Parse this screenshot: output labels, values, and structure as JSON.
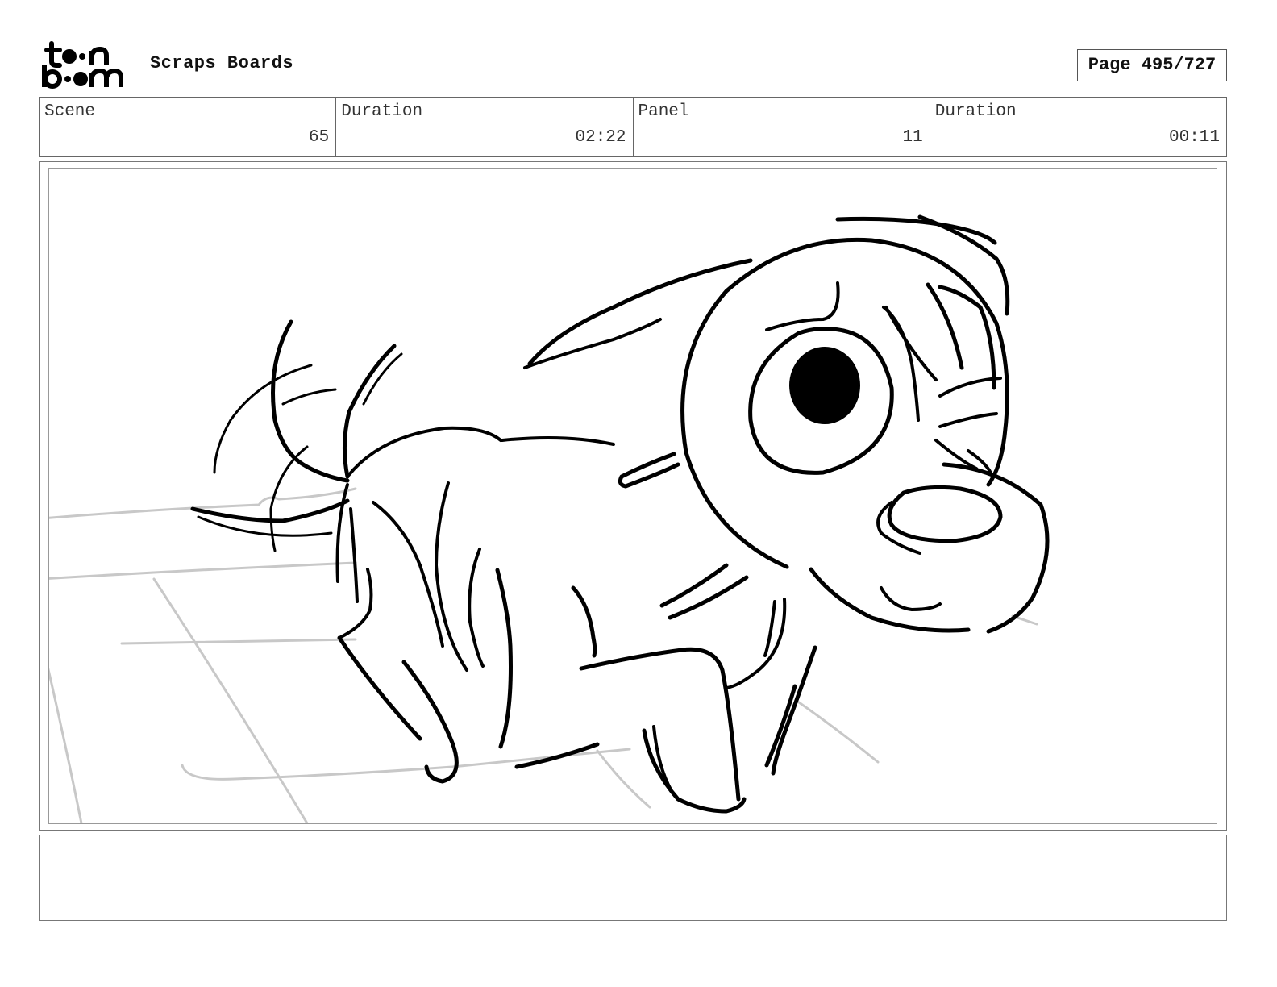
{
  "header": {
    "logo_text": [
      "to",
      "n",
      "b",
      "m"
    ],
    "title": "Scraps Boards",
    "page_indicator": "Page 495/727"
  },
  "info": {
    "scene_label": "Scene",
    "scene_value": "65",
    "scene_duration_label": "Duration",
    "scene_duration_value": "02:22",
    "panel_label": "Panel",
    "panel_value": "11",
    "panel_duration_label": "Duration",
    "panel_duration_value": "00:11"
  },
  "caption": {
    "text": ""
  },
  "colors": {
    "ink": "#000000",
    "rough_line": "#c8c8c8",
    "frame": "#777777"
  }
}
